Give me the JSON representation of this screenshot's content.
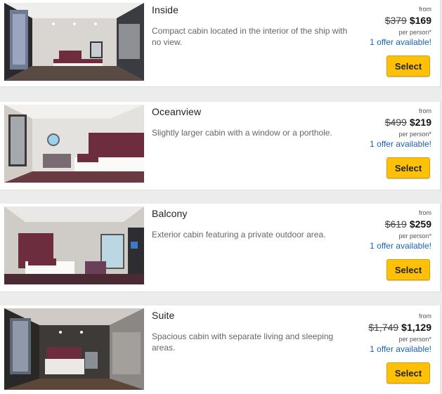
{
  "cabins": [
    {
      "title": "Inside",
      "description": "Compact cabin located in the interior of the ship with no view.",
      "from_label": "from",
      "old_price": "$379",
      "price": "$169",
      "per_person": "per person*",
      "offer": "1 offer available!",
      "select_label": "Select"
    },
    {
      "title": "Oceanview",
      "description": "Slightly larger cabin with a window or a porthole.",
      "from_label": "from",
      "old_price": "$499",
      "price": "$219",
      "per_person": "per person*",
      "offer": "1 offer available!",
      "select_label": "Select"
    },
    {
      "title": "Balcony",
      "description": "Exterior cabin featuring a private outdoor area.",
      "from_label": "from",
      "old_price": "$619",
      "price": "$259",
      "per_person": "per person*",
      "offer": "1 offer available!",
      "select_label": "Select"
    },
    {
      "title": "Suite",
      "description": "Spacious cabin with separate living and sleeping areas.",
      "from_label": "from",
      "old_price": "$1,749",
      "price": "$1,129",
      "per_person": "per person*",
      "offer": "1 offer available!",
      "select_label": "Select"
    }
  ],
  "colors": {
    "select_button": "#ffc107",
    "offer_link": "#1a63b8",
    "accent_headboard": "#6e2c3f"
  }
}
